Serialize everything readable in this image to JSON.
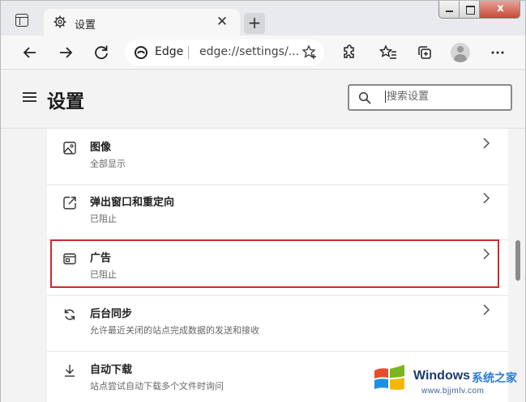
{
  "tab": {
    "title": "设置",
    "close_label": "✕"
  },
  "window_controls": {
    "close_label": "x"
  },
  "address": {
    "brand": "Edge",
    "url": "edge://settings/..."
  },
  "header": {
    "title": "设置",
    "search_placeholder": "搜索设置"
  },
  "rows": [
    {
      "title": "图像",
      "subtitle": "全部显示",
      "icon": "image-icon"
    },
    {
      "title": "弹出窗口和重定向",
      "subtitle": "已阻止",
      "icon": "popup-icon"
    },
    {
      "title": "广告",
      "subtitle": "已阻止",
      "icon": "ads-icon"
    },
    {
      "title": "后台同步",
      "subtitle": "允许最近关闭的站点完成数据的发送和接收",
      "icon": "sync-icon"
    },
    {
      "title": "自动下载",
      "subtitle": "站点尝试自动下载多个文件时询问",
      "icon": "download-icon"
    }
  ],
  "watermark": {
    "brand": "Windows",
    "site_cn": "系统之家",
    "url": "www.bjjmlv.com"
  },
  "colors": {
    "highlight": "#d02a2a",
    "watermark_blue": "#2b7bd6"
  }
}
